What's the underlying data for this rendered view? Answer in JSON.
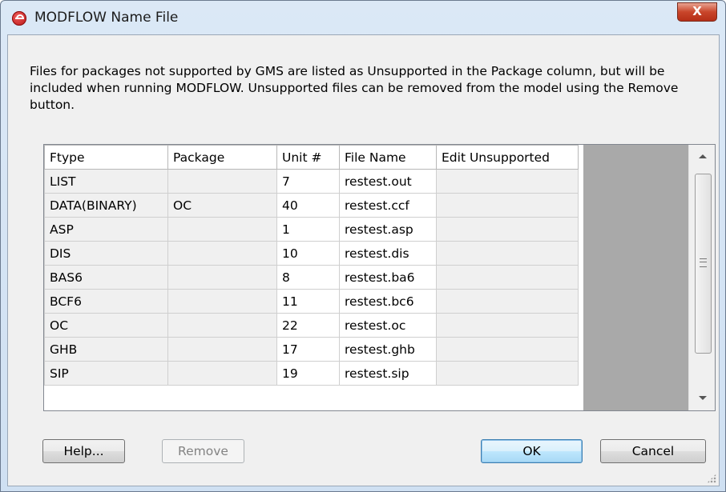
{
  "window": {
    "title": "MODFLOW Name File",
    "close_glyph": "X"
  },
  "description": "Files for packages not supported by GMS are listed as Unsupported in the Package column, but will be included when running MODFLOW.  Unsupported files can be removed from the model using the Remove button.",
  "table": {
    "columns": [
      "Ftype",
      "Package",
      "Unit #",
      "File Name",
      "Edit Unsupported"
    ],
    "rows": [
      {
        "ftype": "LIST",
        "package": "",
        "unit": "7",
        "file": "restest.out",
        "edit": ""
      },
      {
        "ftype": "DATA(BINARY)",
        "package": "OC",
        "unit": "40",
        "file": "restest.ccf",
        "edit": ""
      },
      {
        "ftype": "ASP",
        "package": "",
        "unit": "1",
        "file": "restest.asp",
        "edit": ""
      },
      {
        "ftype": "DIS",
        "package": "",
        "unit": "10",
        "file": "restest.dis",
        "edit": ""
      },
      {
        "ftype": "BAS6",
        "package": "",
        "unit": "8",
        "file": "restest.ba6",
        "edit": ""
      },
      {
        "ftype": "BCF6",
        "package": "",
        "unit": "11",
        "file": "restest.bc6",
        "edit": ""
      },
      {
        "ftype": "OC",
        "package": "",
        "unit": "22",
        "file": "restest.oc",
        "edit": ""
      },
      {
        "ftype": "GHB",
        "package": "",
        "unit": "17",
        "file": "restest.ghb",
        "edit": ""
      },
      {
        "ftype": "SIP",
        "package": "",
        "unit": "19",
        "file": "restest.sip",
        "edit": ""
      }
    ]
  },
  "buttons": {
    "help": "Help...",
    "remove": "Remove",
    "ok": "OK",
    "cancel": "Cancel"
  },
  "icons": {
    "app": "gms-app-icon",
    "close": "close-icon",
    "scroll_up": "chevron-up-icon",
    "scroll_down": "chevron-down-icon",
    "resize": "resize-grip-icon"
  },
  "colors": {
    "grid_empty_area": "#a9a9a9",
    "readonly_cell": "#f0f0f0",
    "close_button": "#c9452a"
  }
}
